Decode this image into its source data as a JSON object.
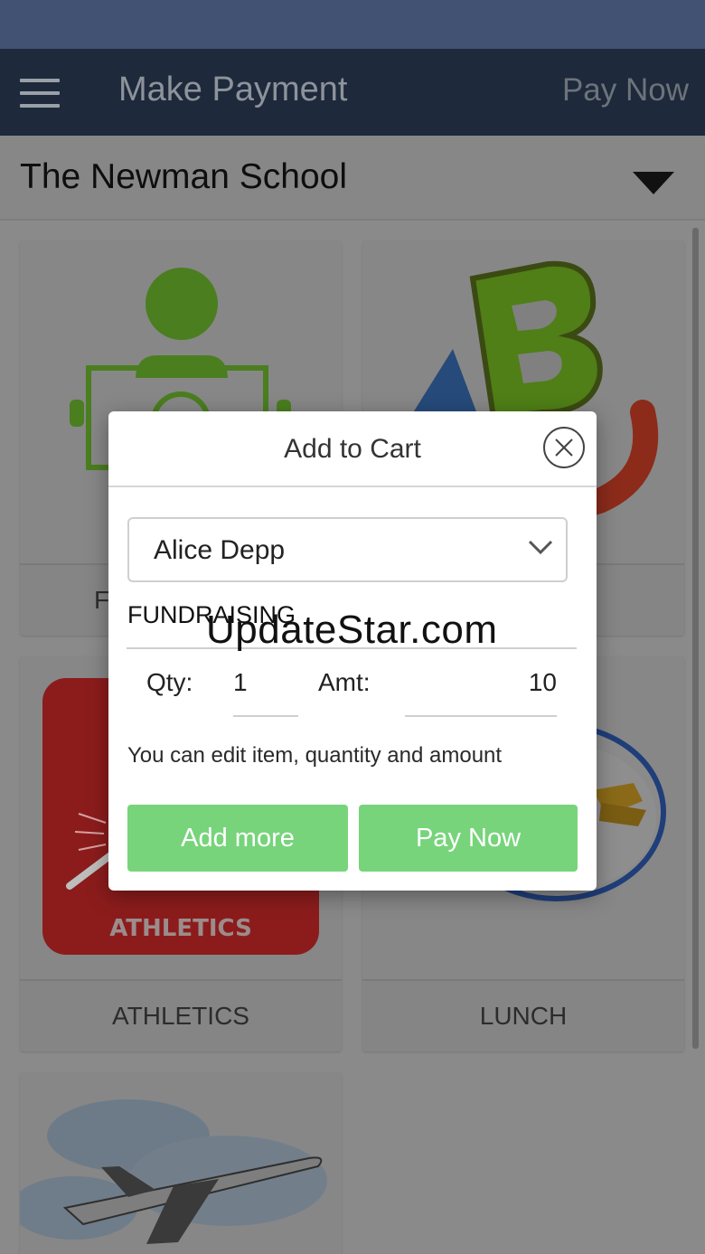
{
  "header": {
    "title": "Make Payment",
    "action_label": "Pay Now"
  },
  "school": {
    "name": "The Newman School"
  },
  "categories": [
    {
      "label": "F",
      "icon": "fundraising-icon"
    },
    {
      "label": "",
      "icon": "abc-letters-icon"
    },
    {
      "label": "ATHLETICS",
      "icon": "athletics-logo",
      "logo_text": "ATHLETICS"
    },
    {
      "label": "LUNCH",
      "icon": "lunch-plate-icon"
    },
    {
      "label": "",
      "icon": "airplane-icon"
    }
  ],
  "modal": {
    "title": "Add to Cart",
    "student": "Alice Depp",
    "item": "FUNDRAISING",
    "qty_label": "Qty:",
    "qty_value": "1",
    "amt_label": "Amt:",
    "amt_value": "10",
    "hint": "You can edit item, quantity and amount",
    "add_more_label": "Add more",
    "pay_now_label": "Pay Now"
  },
  "watermark": "UpdateStar.com",
  "colors": {
    "status_bar": "#415272",
    "app_bar": "#1e293b",
    "button_green": "#77d47b",
    "athletics_red": "#8c1c1c"
  }
}
